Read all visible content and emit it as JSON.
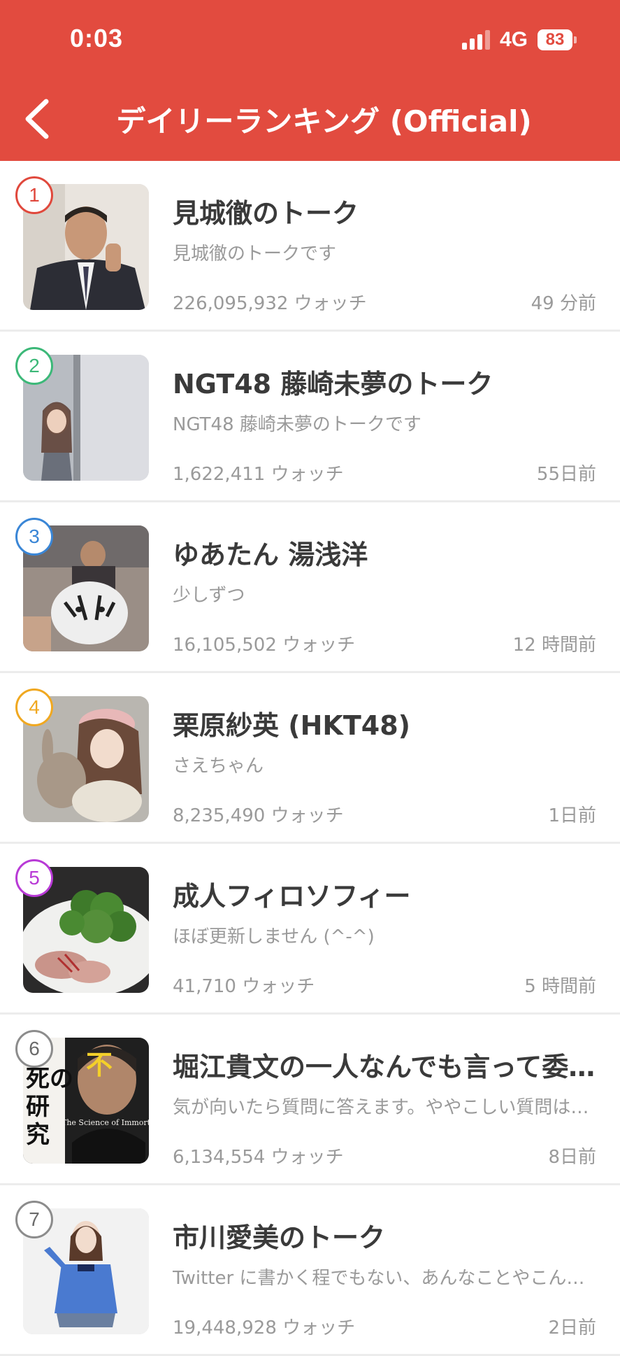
{
  "status_bar": {
    "time": "0:03",
    "network": "4G",
    "battery": "83"
  },
  "header": {
    "title": "デイリーランキング (Official)",
    "back_icon": "chevron-left-icon",
    "background_color": "#e24b3f"
  },
  "rankings": [
    {
      "rank": "1",
      "rank_color": "#e0483c",
      "name": "見城徹のトーク",
      "description": "見城徹のトークです",
      "watchers": "226,095,932 ウォッチ",
      "updated": "49 分前"
    },
    {
      "rank": "2",
      "rank_color": "#3cb878",
      "name": "NGT48 藤崎未夢のトーク",
      "description": "NGT48 藤崎未夢のトークです",
      "watchers": "1,622,411 ウォッチ",
      "updated": "55日前"
    },
    {
      "rank": "3",
      "rank_color": "#3a86d6",
      "name": "ゆあたん 湯浅洋",
      "description": "少しずつ",
      "watchers": "16,105,502 ウォッチ",
      "updated": "12 時間前"
    },
    {
      "rank": "4",
      "rank_color": "#f0a820",
      "name": "栗原紗英 (HKT48)",
      "description": "さえちゃん",
      "watchers": "8,235,490 ウォッチ",
      "updated": "1日前"
    },
    {
      "rank": "5",
      "rank_color": "#b83ad6",
      "name": "成人フィロソフィー",
      "description": "ほぼ更新しません (^-^)",
      "watchers": "41,710 ウォッチ",
      "updated": "5 時間前"
    },
    {
      "rank": "6",
      "rank_color": "#8c8c8c",
      "name": "堀江貴文の一人なんでも言って委員会",
      "description": "気が向いたら質問に答えます。ややこしい質問はお断りします",
      "watchers": "6,134,554 ウォッチ",
      "updated": "8日前"
    },
    {
      "rank": "7",
      "rank_color": "#8c8c8c",
      "name": "市川愛美のトーク",
      "description": "Twitter に書かく程でもない、あんなことやこんなこと",
      "watchers": "19,448,928 ウォッチ",
      "updated": "2日前"
    }
  ],
  "thumbnails": {
    "book_cover_text": [
      "不",
      "死の",
      "研",
      "究"
    ],
    "book_subtitle": "The Science of Immortality"
  }
}
